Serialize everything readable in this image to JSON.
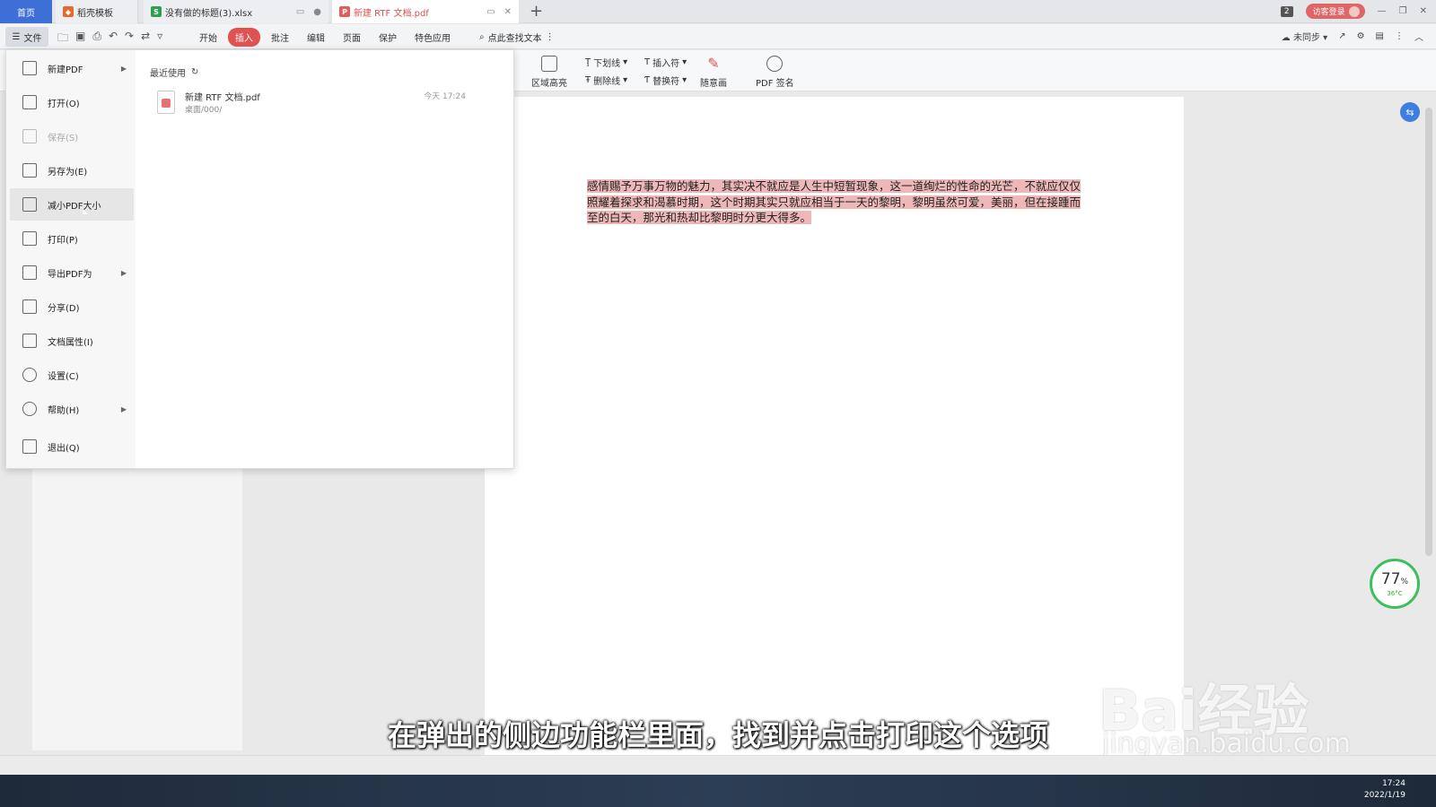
{
  "titlebar": {
    "tabs": [
      {
        "label": "首页"
      },
      {
        "label": "稻壳模板"
      },
      {
        "label": "没有做的标题(3).xlsx"
      },
      {
        "label": "新建 RTF 文档.pdf"
      }
    ],
    "page_count_badge": "2",
    "login_label": "访客登录"
  },
  "menubar": {
    "file_label": "文件",
    "menus": [
      "开始",
      "插入",
      "批注",
      "编辑",
      "页面",
      "保护",
      "特色应用"
    ],
    "active_menu": "插入",
    "find_text": "点此查找文本",
    "sync_label": "未同步"
  },
  "ribbon": {
    "area_highlight": "区域高亮",
    "underline": "下划线",
    "strikethrough": "删除线",
    "insert_symbol": "插入符",
    "replace_symbol": "替换符",
    "freehand": "随意画",
    "pdf_sign": "PDF 签名"
  },
  "file_menu": {
    "items": [
      {
        "label": "新建PDF",
        "has_submenu": true
      },
      {
        "label": "打开(O)"
      },
      {
        "label": "保存(S)",
        "disabled": true
      },
      {
        "label": "另存为(E)"
      },
      {
        "label": "减小PDF大小",
        "hover": true
      },
      {
        "label": "打印(P)"
      },
      {
        "label": "导出PDF为",
        "has_submenu": true
      },
      {
        "label": "分享(D)"
      },
      {
        "label": "文档属性(I)"
      },
      {
        "label": "设置(C)"
      },
      {
        "label": "帮助(H)",
        "has_submenu": true
      },
      {
        "label": "退出(Q)"
      }
    ],
    "recent": {
      "title": "最近使用",
      "files": [
        {
          "name": "新建 RTF 文档.pdf",
          "path": "桌面/000/",
          "time": "今天 17:24"
        }
      ]
    }
  },
  "document": {
    "text": "感情赐予万事万物的魅力，其实决不就应是人生中短暂现象，这一道绚烂的性命的光芒，不就应仅仅照耀着探求和渴慕时期，这个时期其实只就应相当于一天的黎明，黎明虽然可爱，美丽，但在接踵而至的白天，那光和热却比黎明时分更大得多。"
  },
  "gauge": {
    "percent": "77",
    "unit": "%",
    "temp": "36°C"
  },
  "subtitle": "在弹出的侧边功能栏里面，找到并点击打印这个选项",
  "watermark": {
    "brand": "Bai经验",
    "url": "jingyan.baidu.com"
  },
  "taskbar": {
    "time": "17:24",
    "date": "2022/1/19"
  },
  "colors": {
    "accent_red": "#e05252",
    "home_tab_blue": "#3d6fd6",
    "highlight_pink": "#efb8b8"
  }
}
